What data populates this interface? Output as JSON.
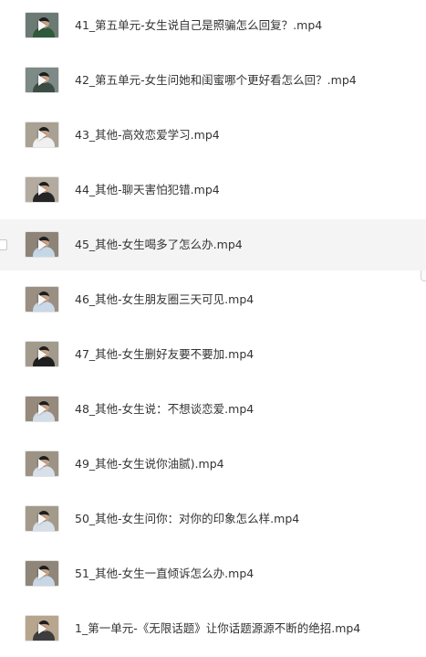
{
  "files": [
    {
      "name": "41_第五单元-女生说自己是照骗怎么回复？.mp4",
      "thumb": {
        "bg": "#6c7a74",
        "shirt": "#2e5a3b"
      }
    },
    {
      "name": "42_第五单元-女生问她和闺蜜哪个更好看怎么回？.mp4",
      "thumb": {
        "bg": "#7d8a87",
        "shirt": "#3c4d44"
      }
    },
    {
      "name": "43_其他-高效恋爱学习.mp4",
      "thumb": {
        "bg": "#a9a193",
        "shirt": "#f0f0f0"
      }
    },
    {
      "name": "44_其他-聊天害怕犯错.mp4",
      "thumb": {
        "bg": "#b3ab9f",
        "shirt": "#252525"
      }
    },
    {
      "name": "45_其他-女生喝多了怎么办.mp4",
      "thumb": {
        "bg": "#8d8377",
        "shirt": "#c5d7e6"
      }
    },
    {
      "name": "46_其他-女生朋友圈三天可见.mp4",
      "thumb": {
        "bg": "#9a8f82",
        "shirt": "#cad8e8"
      }
    },
    {
      "name": "47_其他-女生删好友要不要加.mp4",
      "thumb": {
        "bg": "#a29a8c",
        "shirt": "#1f1f1f"
      }
    },
    {
      "name": "48_其他-女生说：不想谈恋爱.mp4",
      "thumb": {
        "bg": "#968a7c",
        "shirt": "#d3dde8"
      }
    },
    {
      "name": "49_其他-女生说你油腻).mp4",
      "thumb": {
        "bg": "#9d9385",
        "shirt": "#d8e0ea"
      }
    },
    {
      "name": "50_其他-女生问你：对你的印象怎么样.mp4",
      "thumb": {
        "bg": "#a49a8b",
        "shirt": "#d6dfe9"
      }
    },
    {
      "name": "51_其他-女生一直倾诉怎么办.mp4",
      "thumb": {
        "bg": "#8f8679",
        "shirt": "#c8d6e5"
      }
    },
    {
      "name": "1_第一单元-《无限话题》让你话题源源不断的绝招.mp4",
      "thumb": {
        "bg": "#b7a58e",
        "shirt": "#3d3d3d"
      }
    }
  ],
  "hovered_index": 4
}
